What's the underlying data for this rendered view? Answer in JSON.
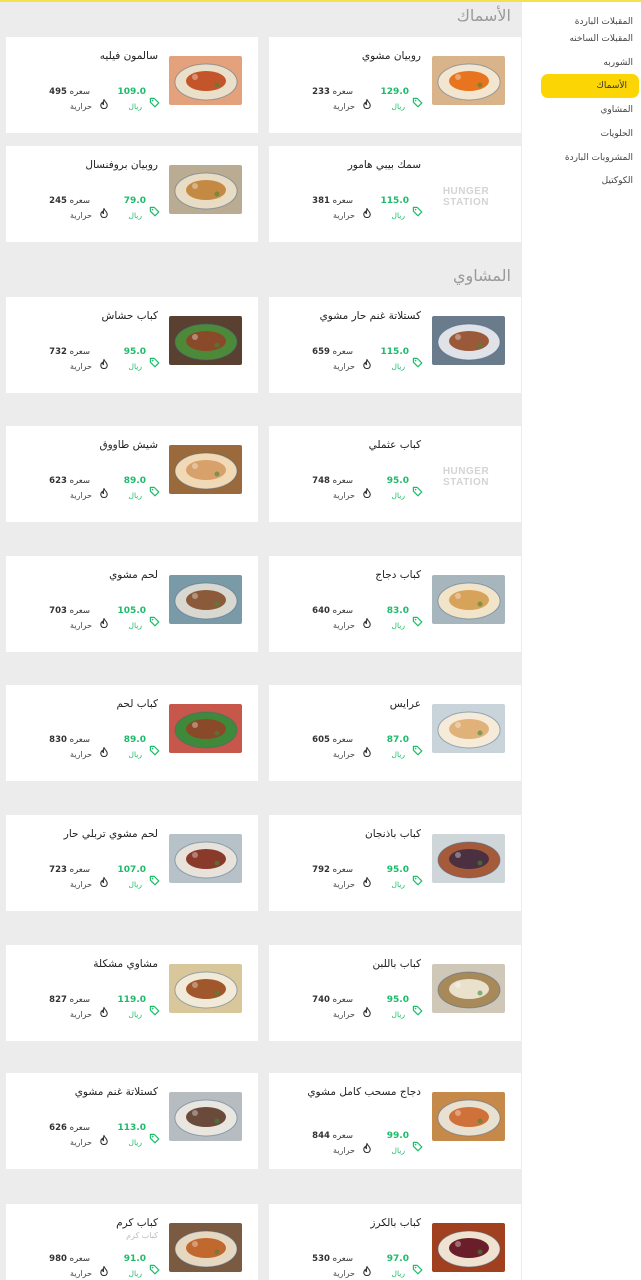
{
  "sidebar": {
    "items": [
      {
        "label": "المقبلات الباردة",
        "active": false
      },
      {
        "label": "المقبلات الساخنه",
        "active": false
      },
      {
        "label": "الشوربه",
        "active": false
      },
      {
        "label": "الأسماك",
        "active": true
      },
      {
        "label": "المشاوي",
        "active": false
      },
      {
        "label": "الحلويات",
        "active": false
      },
      {
        "label": "المشروبات الباردة",
        "active": false
      },
      {
        "label": "الكوكتيل",
        "active": false
      }
    ]
  },
  "sections": [
    {
      "title": "الأسماك"
    },
    {
      "title": "المشاوي"
    }
  ],
  "labels": {
    "calories_unit": "سعره",
    "heat_unit": "حرارية",
    "currency": "ريال",
    "placeholder_logo": "HUNGER STATION"
  },
  "colors": {
    "accent": "#fbd504",
    "price": "#1dbb6a",
    "card_bg": "#ffffff",
    "page_bg": "#ececec",
    "topline": "#f3e24a"
  },
  "items": [
    {
      "name": "روبيان مشوي",
      "price": "129.0",
      "calories": "233",
      "image": "grilled-shrimp"
    },
    {
      "name": "سالمون فيليه",
      "price": "109.0",
      "calories": "495",
      "image": "salmon-fillet"
    },
    {
      "name": "سمك بيبي هامور",
      "price": "115.0",
      "calories": "381",
      "image": "placeholder"
    },
    {
      "name": "روبيان بروفنسال",
      "price": "79.0",
      "calories": "245",
      "image": "shrimp-provencal"
    },
    {
      "name": "كستلاتة غنم حار مشوي",
      "price": "115.0",
      "calories": "659",
      "image": "lamb-chops"
    },
    {
      "name": "كباب حشاش",
      "price": "95.0",
      "calories": "732",
      "image": "kebab-plate"
    },
    {
      "name": "كباب عثملي",
      "price": "95.0",
      "calories": "748",
      "image": "placeholder"
    },
    {
      "name": "شيش طاووق",
      "price": "89.0",
      "calories": "623",
      "image": "shish-tawook"
    },
    {
      "name": "كباب دجاج",
      "price": "83.0",
      "calories": "640",
      "image": "chicken-kebab"
    },
    {
      "name": "لحم مشوي",
      "price": "105.0",
      "calories": "703",
      "image": "grilled-meat"
    },
    {
      "name": "عرايس",
      "price": "87.0",
      "calories": "605",
      "image": "arayes"
    },
    {
      "name": "كباب لحم",
      "price": "89.0",
      "calories": "830",
      "image": "meat-kebab"
    },
    {
      "name": "كباب باذنجان",
      "price": "95.0",
      "calories": "792",
      "image": "eggplant-kebab"
    },
    {
      "name": "لحم مشوي تربلي حار",
      "price": "107.0",
      "calories": "723",
      "image": "spicy-meat"
    },
    {
      "name": "كباب باللبن",
      "price": "95.0",
      "calories": "740",
      "image": "yogurt-kebab"
    },
    {
      "name": "مشاوي مشكلة",
      "price": "119.0",
      "calories": "827",
      "image": "mixed-grill"
    },
    {
      "name": "دجاج مسحب كامل مشوي",
      "price": "99.0",
      "calories": "844",
      "image": "whole-chicken"
    },
    {
      "name": "كستلاتة غنم مشوي",
      "price": "113.0",
      "calories": "626",
      "image": "lamb-cutlets"
    },
    {
      "name": "كباب بالكرز",
      "price": "97.0",
      "calories": "530",
      "image": "cherry-kebab"
    },
    {
      "name": "كباب كرم",
      "subtitle": "كباب كرم",
      "price": "91.0",
      "calories": "980",
      "image": "karam-kebab"
    }
  ]
}
